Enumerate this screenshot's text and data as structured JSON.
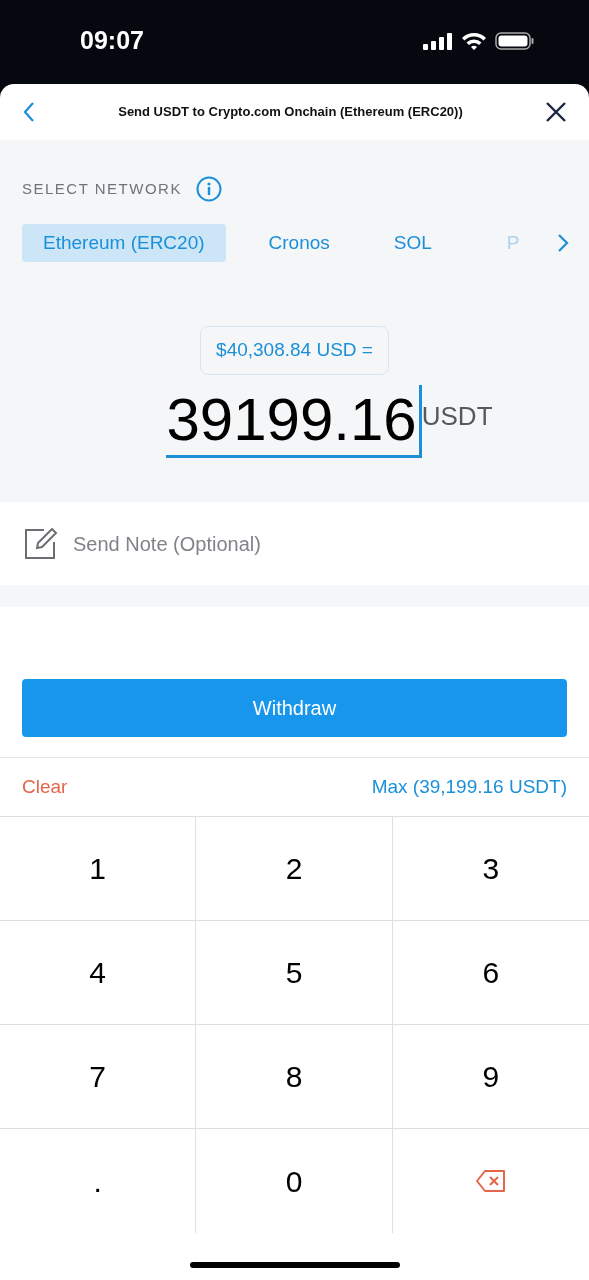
{
  "status_bar": {
    "time": "09:07"
  },
  "header": {
    "title": "Send USDT to Crypto.com Onchain (Ethereum (ERC20))"
  },
  "network": {
    "label": "SELECT NETWORK",
    "tabs": [
      {
        "label": "Ethereum (ERC20)",
        "selected": true
      },
      {
        "label": "Cronos",
        "selected": false
      },
      {
        "label": "SOL",
        "selected": false
      },
      {
        "label": "P",
        "selected": false
      }
    ]
  },
  "amount": {
    "fiat": "$40,308.84 USD =",
    "value": "39199.16",
    "unit": "USDT"
  },
  "note": {
    "placeholder": "Send Note (Optional)"
  },
  "withdraw_button": "Withdraw",
  "clear": "Clear",
  "max": "Max (39,199.16 USDT)",
  "keypad": [
    {
      "kind": "digit",
      "label": "1"
    },
    {
      "kind": "digit",
      "label": "2"
    },
    {
      "kind": "digit",
      "label": "3"
    },
    {
      "kind": "digit",
      "label": "4"
    },
    {
      "kind": "digit",
      "label": "5"
    },
    {
      "kind": "digit",
      "label": "6"
    },
    {
      "kind": "digit",
      "label": "7"
    },
    {
      "kind": "digit",
      "label": "8"
    },
    {
      "kind": "digit",
      "label": "9"
    },
    {
      "kind": "digit",
      "label": "."
    },
    {
      "kind": "digit",
      "label": "0"
    },
    {
      "kind": "backspace"
    }
  ]
}
